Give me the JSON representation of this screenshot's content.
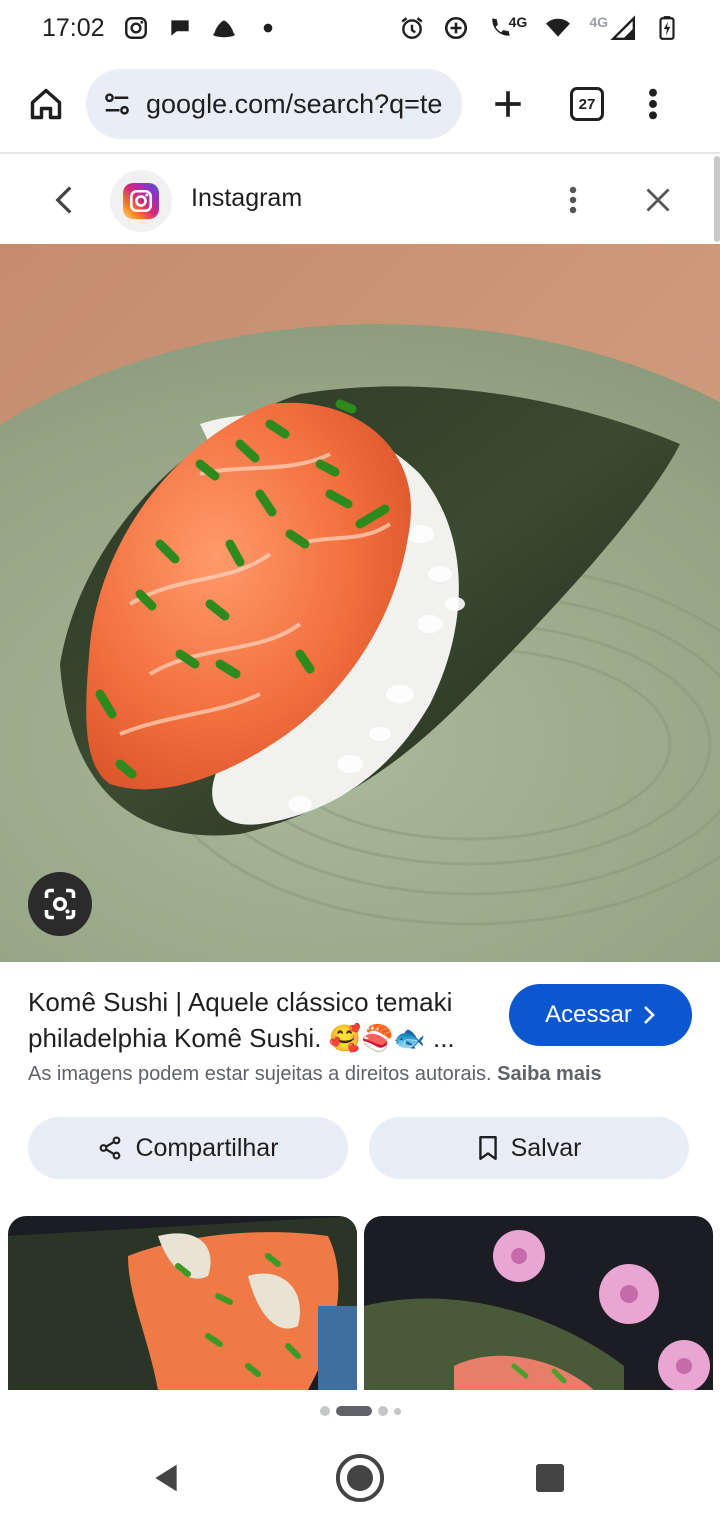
{
  "status_bar": {
    "time": "17:02",
    "network_label_1": "4G",
    "network_label_2": "4G",
    "left_icons": [
      "instagram-icon",
      "chat-bubble-icon",
      "hat-icon",
      "dot-icon"
    ],
    "right_icons": [
      "alarm-icon",
      "data-saver-icon",
      "call-4g-icon",
      "wifi-icon",
      "signal-icon",
      "battery-charging-icon"
    ]
  },
  "browser": {
    "url": "google.com/search?q=te",
    "tab_count": "27",
    "icons": [
      "home-icon",
      "tune-icon",
      "plus-icon",
      "tabs-icon",
      "more-vert-icon"
    ]
  },
  "source": {
    "name": "Instagram",
    "icons": [
      "back-chevron-icon",
      "instagram-logo-icon",
      "more-vert-icon",
      "close-icon"
    ]
  },
  "result": {
    "title_line1": "Komê Sushi | Aquele clássico temaki",
    "title_line2": "philadelphia Komê Sushi. ",
    "title_emojis": "🥰🍣🐟",
    "title_ellipsis": " ...",
    "access_label": "Acessar",
    "copyright_text": "As imagens podem estar sujeitas a direitos autorais.",
    "learn_more": "Saiba mais",
    "share_label": "Compartilhar",
    "save_label": "Salvar"
  },
  "pager": {
    "count": 4,
    "active_index": 1
  },
  "colors": {
    "accent": "#0b57d0",
    "chip_bg": "#e8edf6",
    "nori": "#2f3a2a",
    "salmon": "#f26f3e",
    "plate": "#9aab8c"
  }
}
